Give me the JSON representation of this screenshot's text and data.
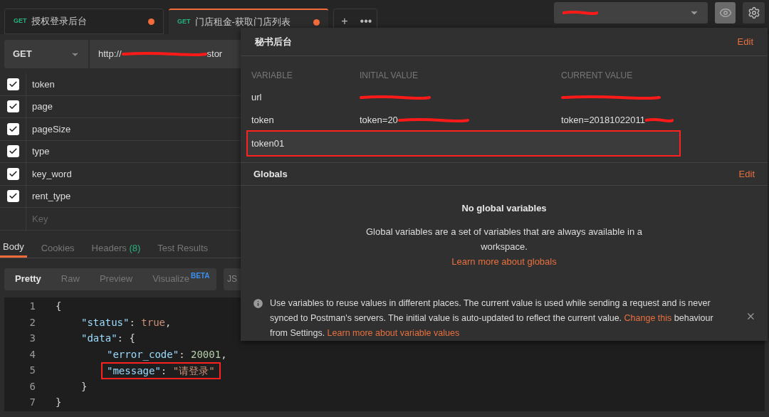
{
  "tabs": [
    {
      "method": "GET",
      "title": "授权登录后台",
      "selected": false,
      "unsaved": true
    },
    {
      "method": "GET",
      "title": "门店租金-获取门店列表",
      "selected": true,
      "unsaved": true
    }
  ],
  "tab_actions": [
    "+",
    "•••"
  ],
  "request": {
    "method": "GET",
    "url_start": "http://",
    "url_end": "stor"
  },
  "params": [
    {
      "key": "token",
      "checked": true
    },
    {
      "key": "page",
      "checked": true
    },
    {
      "key": "pageSize",
      "checked": true
    },
    {
      "key": "type",
      "checked": true
    },
    {
      "key": "key_word",
      "checked": true
    },
    {
      "key": "rent_type",
      "checked": true
    }
  ],
  "params_placeholder": "Key",
  "response_tabs": [
    {
      "label": "Body",
      "selected": true
    },
    {
      "label": "Cookies",
      "selected": false
    },
    {
      "label": "Headers",
      "count": "(8)",
      "selected": false
    },
    {
      "label": "Test Results",
      "selected": false
    }
  ],
  "view_modes": [
    {
      "label": "Pretty",
      "selected": true
    },
    {
      "label": "Raw",
      "selected": false
    },
    {
      "label": "Preview",
      "selected": false
    },
    {
      "label": "Visualize",
      "badge": "BETA",
      "selected": false
    }
  ],
  "format": "JS",
  "code_lines": [
    {
      "number": "1",
      "boxed": false,
      "tokens": [
        {
          "kind": "punct",
          "text": "{"
        }
      ],
      "children": [
        {
          "number": "2",
          "boxed": false,
          "tokens": [
            {
              "kind": "key",
              "text": "\"status\""
            },
            {
              "kind": "punct",
              "text": ": "
            },
            {
              "kind": "literal",
              "text": "true"
            },
            {
              "kind": "punct",
              "text": ","
            }
          ]
        },
        {
          "number": "3",
          "boxed": false,
          "tokens": [
            {
              "kind": "key",
              "text": "\"data\""
            },
            {
              "kind": "punct",
              "text": ": {"
            }
          ],
          "children": [
            {
              "number": "4",
              "boxed": false,
              "tokens": [
                {
                  "kind": "key",
                  "text": "\"error_code\""
                },
                {
                  "kind": "punct",
                  "text": ": "
                },
                {
                  "kind": "number",
                  "text": "20001"
                },
                {
                  "kind": "punct",
                  "text": ","
                }
              ]
            },
            {
              "number": "5",
              "boxed": true,
              "tokens": [
                {
                  "kind": "key",
                  "text": "\"message\""
                },
                {
                  "kind": "punct",
                  "text": ": "
                },
                {
                  "kind": "string",
                  "text": "\"请登录\""
                }
              ]
            }
          ]
        },
        {
          "number": "6",
          "boxed": false,
          "tokens": [
            {
              "kind": "punct",
              "text": "}"
            }
          ]
        }
      ]
    },
    {
      "number": "7",
      "boxed": false,
      "tokens": [
        {
          "kind": "punct",
          "text": "}"
        }
      ]
    }
  ],
  "environment": {
    "eye_active": true
  },
  "popup": {
    "title": "秘书后台",
    "edit": "Edit",
    "columns": [
      "VARIABLE",
      "INITIAL VALUE",
      "CURRENT VALUE"
    ],
    "variables": [
      {
        "name": "url",
        "redacted_initial": true,
        "redacted_current": true,
        "selected": false
      },
      {
        "name": "token",
        "initial": "token=20",
        "current": "token=20181022011",
        "redacted_initial": true,
        "redacted_current": true,
        "selected": false
      },
      {
        "name": "token01",
        "redacted_initial": false,
        "redacted_current": false,
        "selected": true
      }
    ],
    "globals_title": "Globals",
    "globals_edit": "Edit",
    "empty_title": "No global variables",
    "empty_text": "Global variables are a set of variables that are always available in a workspace.",
    "empty_link": "Learn more about globals",
    "info_text": "Use variables to reuse values in different places. The current value is used while sending a request and is never synced to Postman's servers. The initial value is auto-updated to reflect the current value.",
    "info_link": "Change this",
    "info_after": "behaviour from Settings.",
    "info_link2": "Learn more about variable values"
  }
}
